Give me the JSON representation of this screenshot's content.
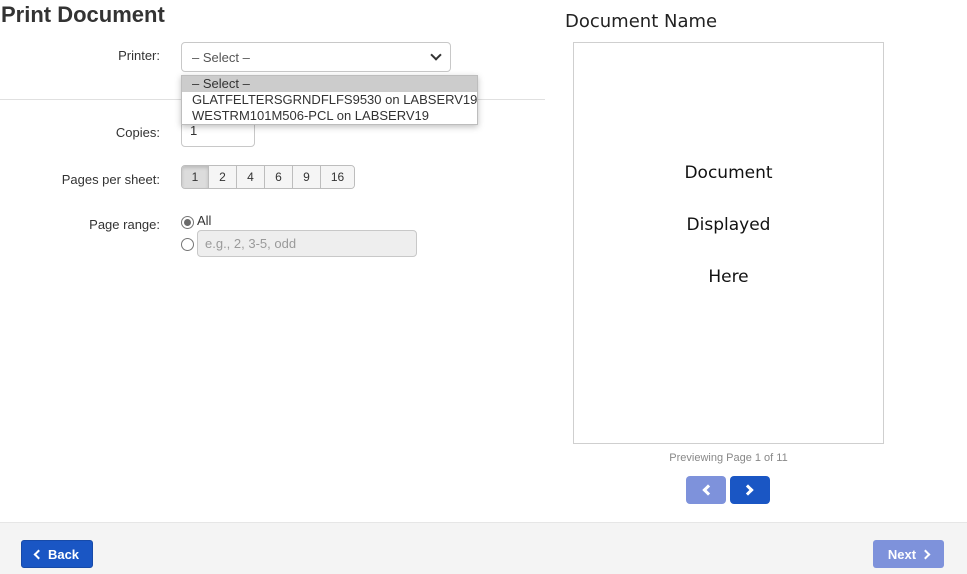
{
  "page": {
    "title": "Print Document"
  },
  "form": {
    "printer_label": "Printer:",
    "printer_selected": "– Select –",
    "printer_options": [
      "– Select –",
      "GLATFELTERSGRNDFLFS9530 on LABSERV19",
      "WESTRM101M506-PCL on LABSERV19"
    ],
    "copies_label": "Copies:",
    "copies_value": "1",
    "pages_per_sheet_label": "Pages per sheet:",
    "pages_per_sheet_options": [
      "1",
      "2",
      "4",
      "6",
      "9",
      "16"
    ],
    "pages_per_sheet_selected": "1",
    "page_range_label": "Page range:",
    "page_range_all_label": "All",
    "page_range_placeholder": "e.g., 2, 3-5, odd",
    "page_range_selected": "All"
  },
  "preview": {
    "document_name": "Document Name",
    "lines": [
      "Document",
      "Displayed",
      "Here"
    ],
    "status_text": "Previewing Page 1 of 11",
    "current_page": 1,
    "total_pages": 11
  },
  "footer": {
    "back_label": "Back",
    "next_label": "Next"
  },
  "colors": {
    "primary": "#1a56c4",
    "primary_disabled": "#7e92db",
    "footer_bg": "#f4f4f4"
  },
  "icons": {
    "prev": "chevron-left-icon",
    "next": "chevron-right-icon",
    "select": "chevron-down-icon"
  }
}
